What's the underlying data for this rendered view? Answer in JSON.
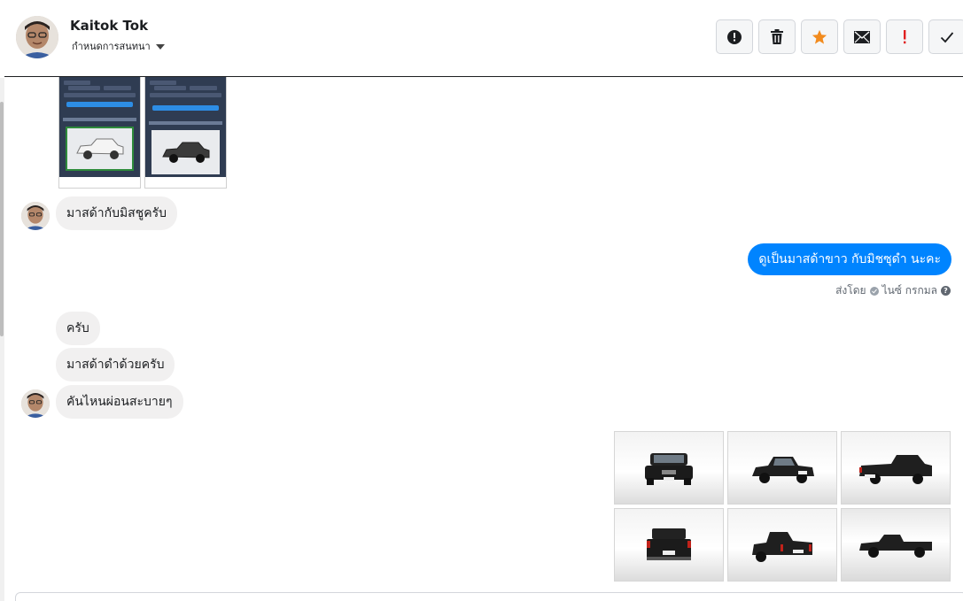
{
  "header": {
    "contact_name": "Kaitok Tok",
    "conversation_label": "กำหนดการสนทนา"
  },
  "actions": [
    {
      "name": "mark-spam-button",
      "icon": "alert-circle-icon"
    },
    {
      "name": "delete-button",
      "icon": "trash-icon"
    },
    {
      "name": "star-button",
      "icon": "star-icon",
      "color": "#f28b1e"
    },
    {
      "name": "mark-unread-button",
      "icon": "envelope-icon"
    },
    {
      "name": "important-button",
      "icon": "exclamation-icon",
      "color": "#e02020"
    },
    {
      "name": "done-button",
      "icon": "check-icon"
    }
  ],
  "messages": {
    "in_1": "มาสด้ากับมิสชูครับ",
    "out_1": "ดูเป็นมาสด้าขาว กับมิชซุดำ นะคะ",
    "sent_by_prefix": "ส่งโดย",
    "sent_by_name": "ไนซ์ กรกมล",
    "in_2": "ครับ",
    "in_3": "มาสด้าดำด้วยครับ",
    "in_4": "คันไหนผ่อนสะบายๆ"
  },
  "colors": {
    "outgoing_bubble": "#0084ff",
    "incoming_bubble": "#f1f0f0"
  }
}
